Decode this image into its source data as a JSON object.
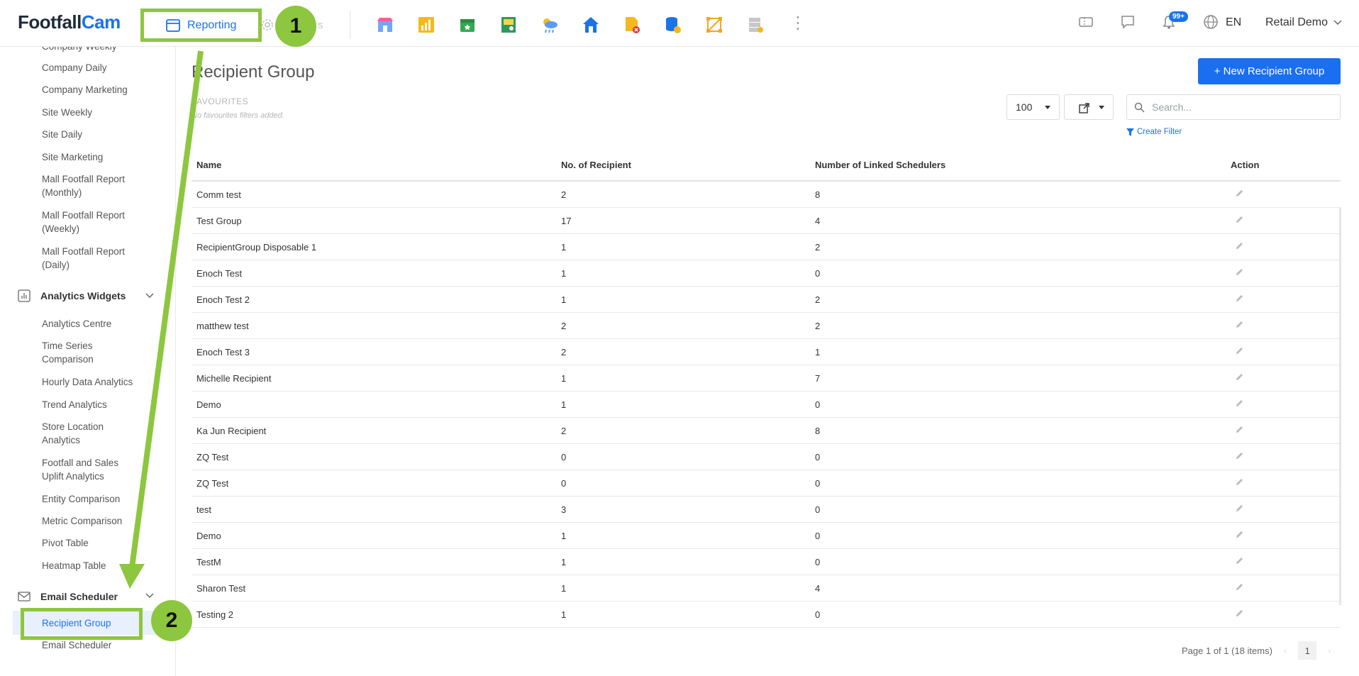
{
  "topbar": {
    "logo_part1": "Footfall",
    "logo_part2": "Cam",
    "reporting_label": "Reporting",
    "faded_tab_suffix": "s",
    "app_icons": [
      "store-icon",
      "chart-icon",
      "calendar-icon",
      "report-icon",
      "weather-icon",
      "home-icon",
      "document-alert-icon",
      "database-icon",
      "grid-icon",
      "server-icon"
    ],
    "notification_badge": "99+",
    "language": "EN",
    "account_name": "Retail Demo"
  },
  "sidebar": {
    "top_links": [
      "Company Weekly",
      "Company Daily",
      "Company Marketing",
      "Site Weekly",
      "Site Daily",
      "Site Marketing"
    ],
    "mall_links": [
      {
        "line1": "Mall Footfall Report",
        "line2": "(Monthly)"
      },
      {
        "line1": "Mall Footfall Report",
        "line2": "(Weekly)"
      },
      {
        "line1": "Mall Footfall Report",
        "line2": "(Daily)"
      }
    ],
    "analytics_section": "Analytics Widgets",
    "analytics_links": [
      {
        "line1": "Analytics Centre",
        "line2": ""
      },
      {
        "line1": "Time Series",
        "line2": "Comparison"
      },
      {
        "line1": "Hourly Data Analytics",
        "line2": ""
      },
      {
        "line1": "Trend Analytics",
        "line2": ""
      },
      {
        "line1": "Store Location",
        "line2": "Analytics"
      },
      {
        "line1": "Footfall and Sales",
        "line2": "Uplift Analytics"
      },
      {
        "line1": "Entity Comparison",
        "line2": ""
      },
      {
        "line1": "Metric Comparison",
        "line2": ""
      },
      {
        "line1": "Pivot Table",
        "line2": ""
      },
      {
        "line1": "Heatmap Table",
        "line2": ""
      }
    ],
    "email_section": "Email Scheduler",
    "recipient_group": "Recipient Group",
    "email_scheduler": "Email Scheduler"
  },
  "main": {
    "title": "Recipient Group",
    "favourites_label": "FAVOURITES",
    "favourites_note": "No favourites filters added.",
    "new_button": "+ New Recipient Group",
    "page_size": "100",
    "search_placeholder": "Search...",
    "create_filter": "Create Filter",
    "columns": [
      "Name",
      "No. of Recipient",
      "Number of Linked Schedulers",
      "Action"
    ],
    "rows": [
      [
        "Comm test",
        "2",
        "8"
      ],
      [
        "Test Group",
        "17",
        "4"
      ],
      [
        "RecipientGroup Disposable 1",
        "1",
        "2"
      ],
      [
        "Enoch Test",
        "1",
        "0"
      ],
      [
        "Enoch Test 2",
        "1",
        "2"
      ],
      [
        "matthew test",
        "2",
        "2"
      ],
      [
        "Enoch Test 3",
        "2",
        "1"
      ],
      [
        "Michelle Recipient",
        "1",
        "7"
      ],
      [
        "Demo",
        "1",
        "0"
      ],
      [
        "Ka Jun Recipient",
        "2",
        "8"
      ],
      [
        "ZQ Test",
        "0",
        "0"
      ],
      [
        "ZQ Test",
        "0",
        "0"
      ],
      [
        "test",
        "3",
        "0"
      ],
      [
        "Demo",
        "1",
        "0"
      ],
      [
        "TestM",
        "1",
        "0"
      ],
      [
        "Sharon Test",
        "1",
        "4"
      ],
      [
        "Testing 2",
        "1",
        "0"
      ]
    ],
    "pagination_text": "Page 1 of 1 (18 items)",
    "current_page": "1"
  },
  "annotations": {
    "step1": "1",
    "step2": "2",
    "accent_color": "#8dc63f"
  },
  "colors": {
    "brand_blue": "#1a73e8",
    "button_blue": "#1a6ff0"
  }
}
